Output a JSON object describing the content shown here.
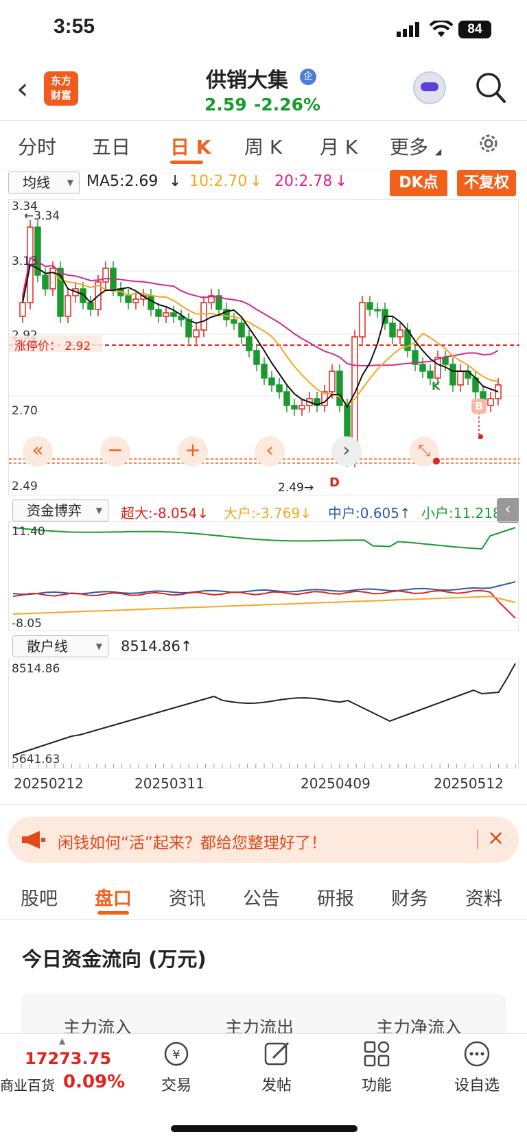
{
  "status_bar": {
    "time": "3:55",
    "battery": "84"
  },
  "header": {
    "logo_line1": "东方",
    "logo_line2": "财富",
    "stock_name": "供销大集",
    "badge": "企",
    "price": "2.59",
    "change_pct": "-2.26%"
  },
  "period_tabs": [
    "分时",
    "五日",
    "日 K",
    "周 K",
    "月 K",
    "更多"
  ],
  "active_period": "日 K",
  "ma_row": {
    "select": "均线",
    "ma5": "MA5:2.69",
    "ma10": "10:2.70",
    "ma20": "20:2.78",
    "dk_button": "DK点",
    "adjust_button": "不复权"
  },
  "kline": {
    "y_labels": [
      "3.34",
      "3.13",
      "2.92",
      "2.70",
      "2.49"
    ],
    "max_marker": "3.34",
    "min_marker": "2.49",
    "limit_label": "涨停价： 2.92",
    "signal_k1": "K",
    "signal_k2": "K",
    "signal_d": "D",
    "signal_b": "B"
  },
  "fund_row": {
    "select": "资金博弈",
    "super": "超大:-8.054",
    "large": "大户:-3.769",
    "medium": "中户:0.605",
    "small": "小户:11.218",
    "y_top": "11.40",
    "y_bottom": "-8.05"
  },
  "retail_row": {
    "select": "散户线",
    "value": "8514.86",
    "y_top": "8514.86",
    "y_bottom": "5641.63"
  },
  "dates": [
    "20250212",
    "20250311",
    "20250409",
    "20250512"
  ],
  "banner": {
    "text": "闲钱如何“活”起来？都给您整理好了！"
  },
  "bottom_tabs": [
    "股吧",
    "盘口",
    "资讯",
    "公告",
    "研报",
    "财务",
    "资料"
  ],
  "active_bottom_tab": "盘口",
  "flow": {
    "title": "今日资金流向 (万元)",
    "columns": [
      "主力流入",
      "主力流出",
      "主力净流入"
    ]
  },
  "bottom_nav": {
    "index_value": "17273.75",
    "index_name": "商业百货",
    "index_change": "0.09%",
    "items": [
      "交易",
      "发帖",
      "功能",
      "设自选"
    ]
  },
  "colors": {
    "accent": "#f0621c",
    "down": "#1a9a2e",
    "up": "#e0231c",
    "ma5": "#111111",
    "ma10": "#f5a623",
    "ma20": "#d9268a"
  }
}
